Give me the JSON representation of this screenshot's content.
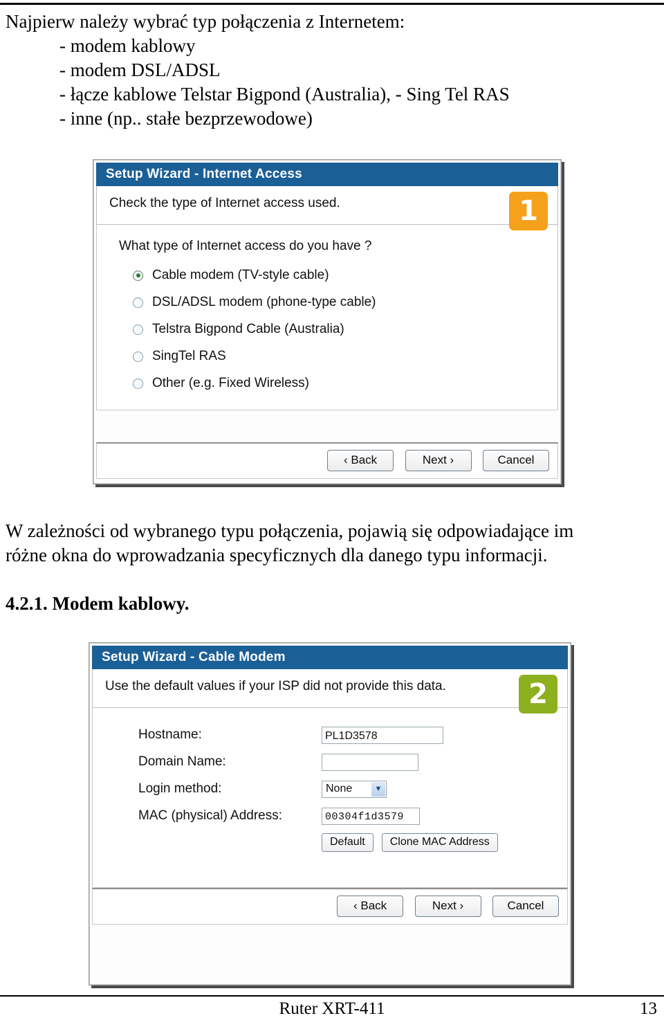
{
  "document": {
    "intro_lead": "Najpierw należy wybrać typ połączenia z Internetem:",
    "intro_bullets": [
      "- modem kablowy",
      "- modem DSL/ADSL",
      "- łącze kablowe Telstar Bigpond (Australia), - Sing Tel RAS",
      "- inne (np.. stałe bezprzewodowe)"
    ],
    "paragraph_line1": "W zależności od wybranego typu połączenia, pojawią się odpowiadające im",
    "paragraph_line2": "różne okna do wprowadzania specyficznych dla danego typu informacji.",
    "section_heading": "4.2.1. Modem kablowy."
  },
  "footer": {
    "center": "Ruter XRT-411",
    "page_number": "13"
  },
  "dialog_internet_access": {
    "title": "Setup Wizard - Internet Access",
    "instruction": "Check the type of Internet access used.",
    "step_badge": "1",
    "step_badge_color": "#f5a11b",
    "question": "What type of Internet access do you have ?",
    "options": [
      {
        "label": "Cable modem (TV-style cable)",
        "selected": true
      },
      {
        "label": "DSL/ADSL modem (phone-type cable)",
        "selected": false
      },
      {
        "label": "Telstra Bigpond Cable (Australia)",
        "selected": false
      },
      {
        "label": "SingTel RAS",
        "selected": false
      },
      {
        "label": "Other (e.g. Fixed Wireless)",
        "selected": false
      }
    ],
    "buttons": {
      "back": "‹ Back",
      "next": "Next ›",
      "cancel": "Cancel"
    }
  },
  "dialog_cable_modem": {
    "title": "Setup Wizard - Cable Modem",
    "instruction": "Use the default values if your ISP did not provide this data.",
    "step_badge": "2",
    "step_badge_color": "#8cb01e",
    "fields": {
      "hostname_label": "Hostname:",
      "hostname_value": "PL1D3578",
      "domain_label": "Domain Name:",
      "domain_value": "",
      "login_label": "Login method:",
      "login_value": "None",
      "mac_label": "MAC (physical) Address:",
      "mac_value": "00304f1d3579"
    },
    "actions": {
      "default": "Default",
      "clone_mac": "Clone MAC Address"
    },
    "buttons": {
      "back": "‹ Back",
      "next": "Next ›",
      "cancel": "Cancel"
    }
  },
  "colors": {
    "titlebar_blue": "#1b5f97",
    "badge_orange": "#f5a11b",
    "badge_green": "#8cb01e",
    "radio_selected_green": "#2f7d32"
  }
}
